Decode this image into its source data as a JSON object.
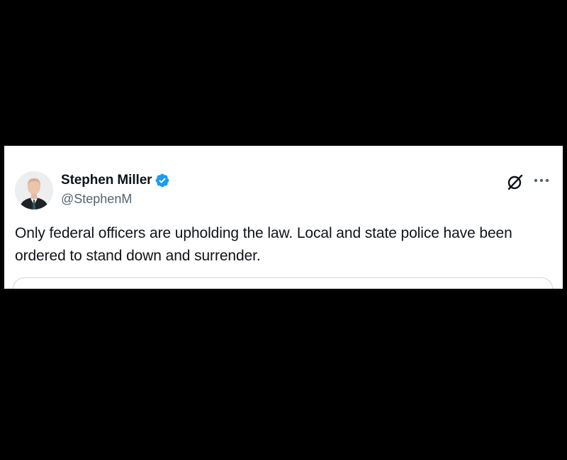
{
  "tweet": {
    "author": {
      "display_name": "Stephen Miller",
      "handle": "@StephenM",
      "verified": true,
      "verified_color": "#1d9bf0"
    },
    "text": "Only federal officers are upholding the law. Local and state police have been ordered to stand down and surrender.",
    "actions": {
      "grok_icon": "grok-icon",
      "more_icon": "more-options-icon"
    }
  },
  "colors": {
    "background": "#000000",
    "card": "#ffffff",
    "text_primary": "#0f1419",
    "text_secondary": "#536471",
    "border": "#cfd9de"
  }
}
